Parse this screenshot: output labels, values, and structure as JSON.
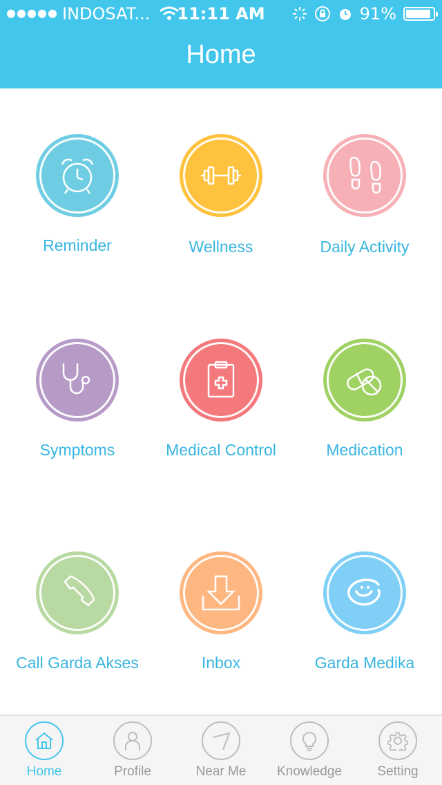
{
  "status_bar": {
    "carrier": "INDOSAT...",
    "time": "11:11 AM",
    "battery": "91%"
  },
  "header": {
    "title": "Home"
  },
  "tiles": [
    {
      "label": "Reminder",
      "color": "#6fcde3",
      "icon": "alarm-clock-icon"
    },
    {
      "label": "Wellness",
      "color": "#ffc23e",
      "icon": "dumbbell-icon"
    },
    {
      "label": "Daily Activity",
      "color": "#f6b0b6",
      "icon": "footprints-icon"
    },
    {
      "label": "Symptoms",
      "color": "#b79bc7",
      "icon": "stethoscope-icon"
    },
    {
      "label": "Medical Control",
      "color": "#f4797c",
      "icon": "clipboard-icon"
    },
    {
      "label": "Medication",
      "color": "#9fd163",
      "icon": "pills-icon"
    },
    {
      "label": "Call Garda Akses",
      "color": "#b8d9a2",
      "icon": "phone-icon"
    },
    {
      "label": "Inbox",
      "color": "#ffb782",
      "icon": "inbox-download-icon"
    },
    {
      "label": "Garda Medika",
      "color": "#7fcff6",
      "icon": "garda-medika-logo-icon"
    }
  ],
  "tabbar": {
    "items": [
      {
        "label": "Home",
        "icon": "home-icon",
        "active": true
      },
      {
        "label": "Profile",
        "icon": "person-icon",
        "active": false
      },
      {
        "label": "Near Me",
        "icon": "compass-icon",
        "active": false
      },
      {
        "label": "Knowledge",
        "icon": "lightbulb-icon",
        "active": false
      },
      {
        "label": "Setting",
        "icon": "gear-icon",
        "active": false
      }
    ],
    "active_color": "#42c6ec"
  },
  "colors": {
    "header_bg": "#42c6ec",
    "label_text": "#38b6e0"
  }
}
